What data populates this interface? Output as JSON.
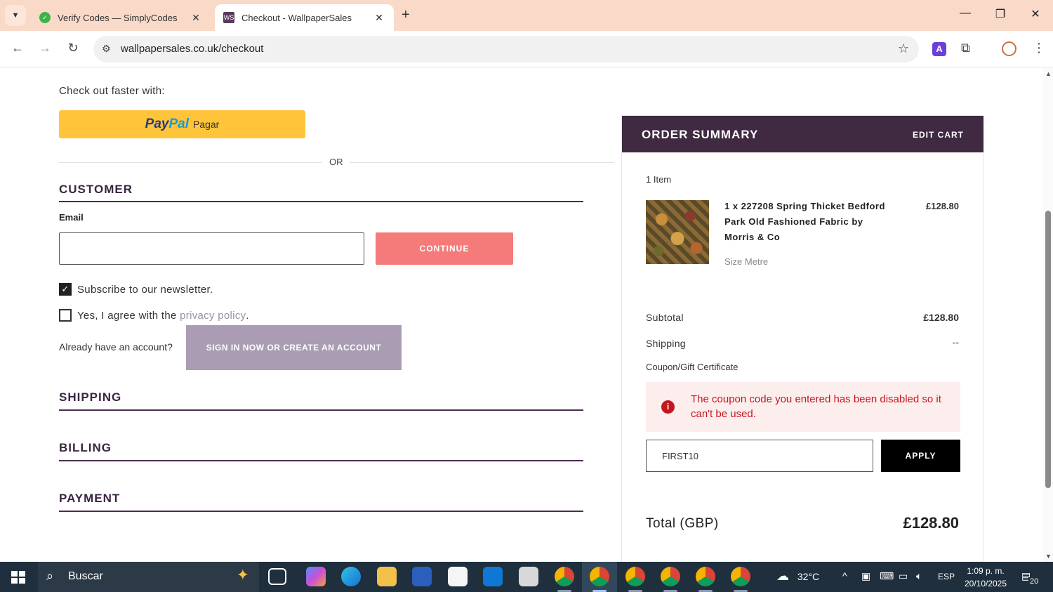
{
  "browser": {
    "tabs": [
      {
        "title": "Verify Codes — SimplyCodes",
        "favicon_color": "#3ab34a"
      },
      {
        "title": "Checkout - WallpaperSales",
        "favicon_text": "WS",
        "favicon_color": "#5b3a5f"
      }
    ],
    "url": "wallpapersales.co.uk/checkout"
  },
  "checkout": {
    "faster_label": "Check out faster with:",
    "paypal_brand_a": "Pay",
    "paypal_brand_b": "Pal",
    "paypal_label": "Pagar",
    "or_label": "OR",
    "customer_title": "CUSTOMER",
    "email_label": "Email",
    "email_value": "",
    "continue_label": "CONTINUE",
    "newsletter_label": "Subscribe to our newsletter.",
    "newsletter_checked": true,
    "agree_prefix": "Yes, I agree with the ",
    "privacy_link": "privacy policy",
    "agree_suffix": ".",
    "agree_checked": false,
    "account_text": "Already have an account?",
    "signin_label": "SIGN IN NOW OR CREATE AN ACCOUNT",
    "shipping_title": "SHIPPING",
    "billing_title": "BILLING",
    "payment_title": "PAYMENT"
  },
  "summary": {
    "title": "ORDER SUMMARY",
    "edit_cart": "EDIT CART",
    "item_count": "1 Item",
    "item": {
      "name": "1 x 227208 Spring Thicket Bedford Park Old Fashioned Fabric by Morris & Co",
      "price": "£128.80",
      "size": "Size Metre"
    },
    "subtotal_label": "Subtotal",
    "subtotal_value": "£128.80",
    "shipping_label": "Shipping",
    "shipping_value": "--",
    "coupon_label": "Coupon/Gift Certificate",
    "alert_message": "The coupon code you entered has been disabled so it can't be used.",
    "coupon_value": "FIRST10",
    "apply_label": "APPLY",
    "total_label": "Total (GBP)",
    "total_value": "£128.80"
  },
  "taskbar": {
    "search_text": "Buscar",
    "temperature": "32°C",
    "language": "ESP",
    "time": "1:09 p. m.",
    "date": "20/10/2025",
    "notifications": "20"
  },
  "colors": {
    "brand_purple": "#3f2a42",
    "continue_bg": "#f57a7a",
    "signin_bg": "#a99cb3",
    "paypal_yellow": "#ffc439",
    "error_red": "#c4161c"
  }
}
